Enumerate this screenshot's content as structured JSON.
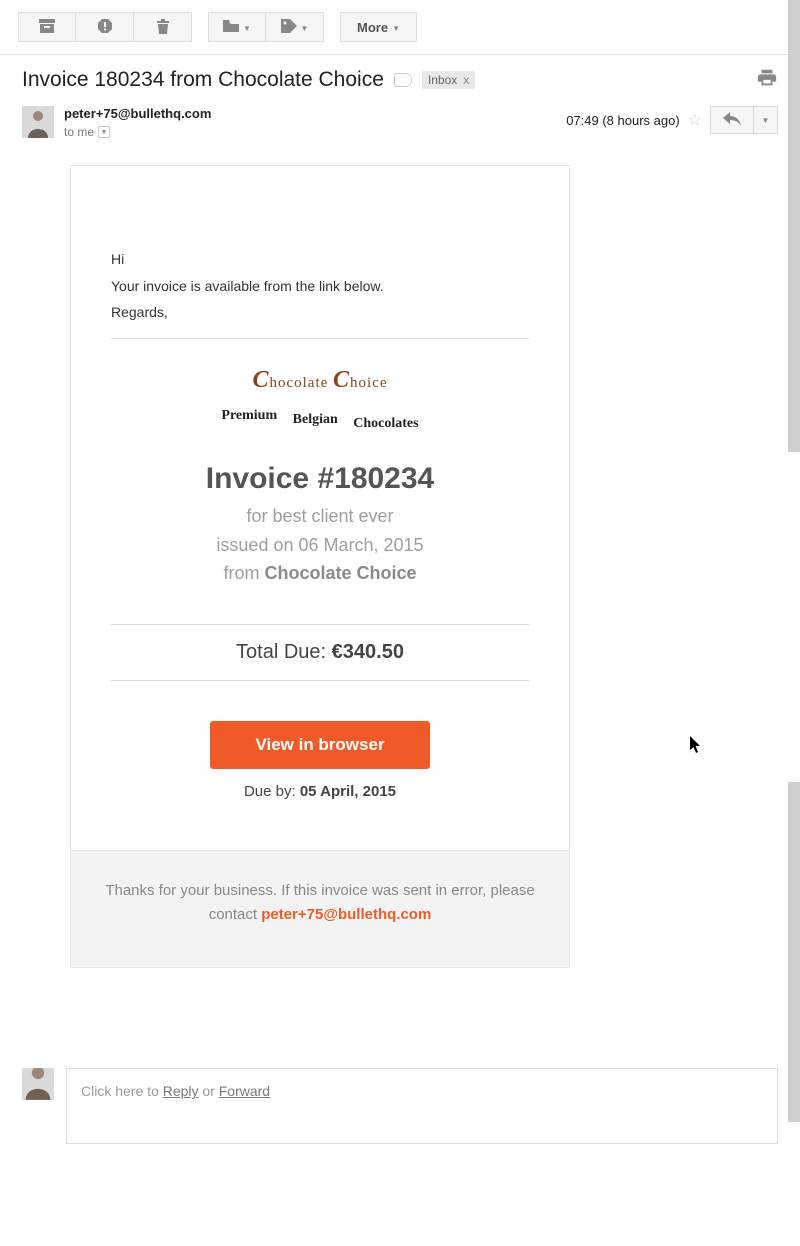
{
  "toolbar": {
    "more_label": "More"
  },
  "subject": {
    "text": "Invoice 180234 from Chocolate Choice",
    "inbox_label": "Inbox",
    "inbox_x": "x"
  },
  "header": {
    "sender_email": "peter+75@bullethq.com",
    "to_line": "to me",
    "time_text": "07:49 (8 hours ago)"
  },
  "body": {
    "greeting": "Hi",
    "line1": "Your invoice is available from the link below.",
    "signoff": "Regards,",
    "logo_brand": "hocolate",
    "logo_brand2": "hoice",
    "logo_w1": "Premium",
    "logo_w2": "Belgian",
    "logo_w3": "Chocolates",
    "invoice_title": "Invoice #180234",
    "sub_for": "for best client ever",
    "sub_issued": "issued on 06 March, 2015",
    "sub_from_prefix": "from ",
    "sub_from_strong": "Chocolate Choice",
    "total_label": "Total Due: ",
    "total_amount": "€340.50",
    "view_btn": "View in browser",
    "due_prefix": "Due by: ",
    "due_date": "05 April, 2015"
  },
  "footer": {
    "text_a": "Thanks for your business. If this invoice was sent in error, please contact ",
    "email": "peter+75@bullethq.com"
  },
  "reply": {
    "prefix": "Click here to ",
    "reply_label": "Reply",
    "sep": " or ",
    "forward_label": "Forward"
  }
}
